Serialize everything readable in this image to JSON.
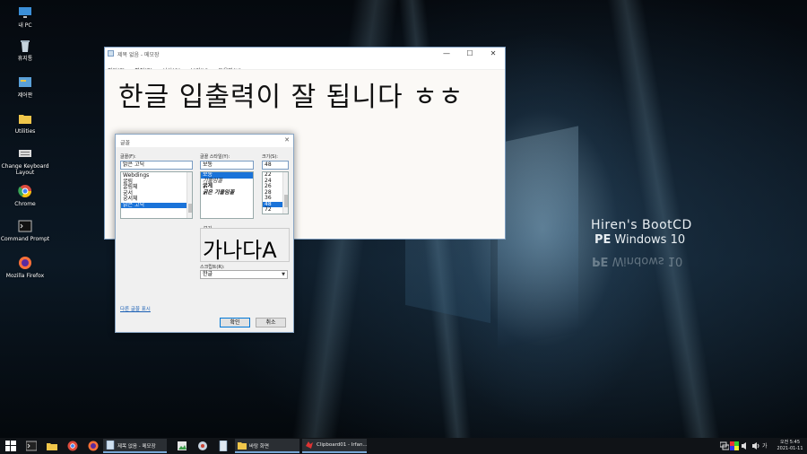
{
  "desktop": {
    "brand_line1": "Hiren's BootCD",
    "brand_line2_bold": "PE",
    "brand_line2_rest": "Windows 10",
    "icons": [
      {
        "label": "내 PC"
      },
      {
        "label": "휴지통"
      },
      {
        "label": "제어판"
      },
      {
        "label": "Utilities"
      },
      {
        "label": "Change Keyboard Layout"
      },
      {
        "label": "Chrome"
      },
      {
        "label": "Command Prompt"
      },
      {
        "label": "Mozilla Firefox"
      }
    ]
  },
  "notepad": {
    "title": "제목 없음 - 메모장",
    "menu": [
      "파일(F)",
      "편집(E)",
      "서식(O)",
      "보기(V)",
      "도움말(H)"
    ],
    "content": "한글 입출력이 잘 됩니다 ㅎㅎ",
    "minimize_glyph": "—",
    "maximize_glyph": "☐",
    "close_glyph": "✕"
  },
  "font_dialog": {
    "title": "글꼴",
    "close_glyph": "✕",
    "font_label": "글꼴(F):",
    "font_value": "맑은 고딕",
    "font_list": [
      "Webdings",
      "굴림",
      "굴림체",
      "궁서",
      "궁서체",
      "맑은 고딕"
    ],
    "font_selected_index": 5,
    "style_label": "글꼴 스타일(Y):",
    "style_value": "보통",
    "style_list": [
      "보통",
      "기울임꼴",
      "굵게",
      "굵은 기울임꼴"
    ],
    "style_selected_index": 0,
    "size_label": "크기(S):",
    "size_value": "48",
    "size_list": [
      "22",
      "24",
      "26",
      "28",
      "36",
      "48",
      "72"
    ],
    "size_selected_index": 5,
    "preview_label": "보기",
    "preview_text": "가나다A",
    "script_label": "스크립트(R):",
    "script_value": "한글",
    "more_fonts_link": "다른 글꼴 표시",
    "ok_label": "확인",
    "cancel_label": "취소"
  },
  "taskbar": {
    "tasks": [
      {
        "label": "제목 없음 - 메모장"
      },
      {
        "label": "바탕 화면"
      },
      {
        "label": "Clipboard01 - Irfan..."
      }
    ],
    "tray_lang": "가",
    "clock_time": "오전 5:45",
    "clock_date": "2021-01-11"
  },
  "colors": {
    "accent": "#1a73d9",
    "taskbar": "#101317"
  }
}
